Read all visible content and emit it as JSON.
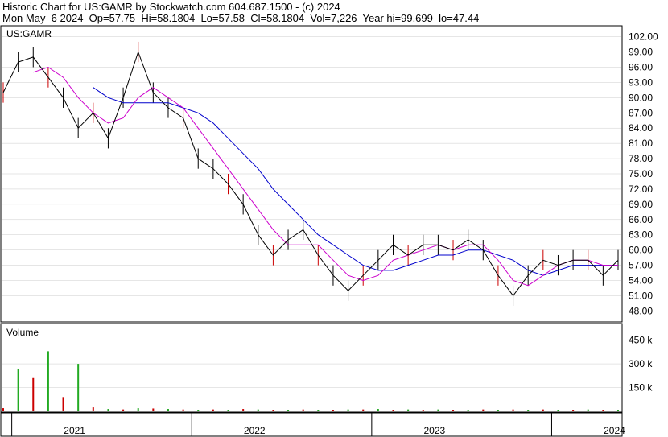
{
  "header": {
    "title": "Historic Chart for US:GAMR by Stockwatch.com 604.687.1500 - (c) 2024",
    "quote_line": "Mon May  6 2024  Op=57.75  Hi=58.1804  Lo=57.58  Cl=58.1804  Vol=7,226  Year hi=99.699  lo=47.44"
  },
  "colors": {
    "price": "#000000",
    "up_bar": "#cc0000",
    "ma_short": "#cc00cc",
    "ma_long": "#0000cc",
    "vol_up": "#22aa22",
    "vol_down": "#cc0000",
    "grid": "#cccccc"
  },
  "chart_data": [
    {
      "type": "line",
      "label": "US:GAMR",
      "ylim": [
        46,
        104
      ],
      "yticks": [
        "102.00",
        "99.00",
        "96.00",
        "93.00",
        "90.00",
        "87.00",
        "84.00",
        "81.00",
        "78.00",
        "75.00",
        "72.00",
        "69.00",
        "66.00",
        "63.00",
        "60.00",
        "57.00",
        "54.00",
        "51.00",
        "48.00"
      ],
      "x": [
        "2020-12",
        "2021-01",
        "2021-02",
        "2021-03",
        "2021-04",
        "2021-05",
        "2021-06",
        "2021-07",
        "2021-08",
        "2021-09",
        "2021-10",
        "2021-11",
        "2021-12",
        "2022-01",
        "2022-02",
        "2022-03",
        "2022-04",
        "2022-05",
        "2022-06",
        "2022-07",
        "2022-08",
        "2022-09",
        "2022-10",
        "2022-11",
        "2022-12",
        "2023-01",
        "2023-02",
        "2023-03",
        "2023-04",
        "2023-05",
        "2023-06",
        "2023-07",
        "2023-08",
        "2023-09",
        "2023-10",
        "2023-11",
        "2023-12",
        "2024-01",
        "2024-02",
        "2024-03",
        "2024-04",
        "2024-05"
      ],
      "series": [
        {
          "values": [
            91,
            97,
            98,
            94,
            90,
            84,
            87,
            82,
            90,
            99,
            91,
            88,
            86,
            78,
            76,
            73,
            69,
            63,
            59,
            62,
            64,
            59,
            55,
            52,
            55,
            58,
            61,
            59,
            61,
            61,
            60,
            62,
            60,
            55,
            51,
            55,
            58,
            57,
            58,
            58,
            55,
            58
          ]
        },
        {
          "values": [
            null,
            null,
            95,
            96,
            94,
            90,
            87,
            85,
            86,
            90,
            92,
            90,
            88,
            84,
            80,
            76,
            72,
            68,
            64,
            61,
            61,
            61,
            58,
            55,
            54,
            55,
            58,
            59,
            60,
            61,
            60,
            61,
            61,
            58,
            54,
            53,
            55,
            57,
            58,
            58,
            57,
            57
          ]
        },
        {
          "values": [
            null,
            null,
            null,
            null,
            null,
            null,
            92,
            90,
            89,
            89,
            89,
            89,
            88,
            87,
            85,
            82,
            79,
            76,
            72,
            69,
            66,
            63,
            61,
            59,
            57,
            56,
            56,
            57,
            58,
            59,
            59,
            60,
            60,
            59,
            58,
            56,
            55,
            56,
            57,
            57,
            57,
            57
          ]
        }
      ]
    },
    {
      "type": "bar",
      "label": "Volume",
      "yticks": [
        "450 k",
        "300 k",
        "150 k"
      ],
      "ylim": [
        0,
        550
      ],
      "x": [
        "2020-12",
        "2021-01",
        "2021-02",
        "2021-03",
        "2021-04",
        "2021-05",
        "2021-06",
        "2021-07",
        "2021-08",
        "2021-09",
        "2021-10",
        "2021-11",
        "2021-12",
        "2022-01",
        "2022-02",
        "2022-03",
        "2022-04",
        "2022-05",
        "2022-06",
        "2022-07",
        "2022-08",
        "2022-09",
        "2022-10",
        "2022-11",
        "2022-12",
        "2023-01",
        "2023-02",
        "2023-03",
        "2023-04",
        "2023-05",
        "2023-06",
        "2023-07",
        "2023-08",
        "2023-09",
        "2023-10",
        "2023-11",
        "2023-12",
        "2024-01",
        "2024-02",
        "2024-03",
        "2024-04",
        "2024-05"
      ],
      "values": [
        20,
        270,
        210,
        380,
        90,
        300,
        25,
        15,
        12,
        20,
        18,
        15,
        12,
        10,
        12,
        10,
        15,
        12,
        10,
        10,
        12,
        10,
        10,
        12,
        12,
        15,
        10,
        12,
        10,
        12,
        10,
        10,
        12,
        10,
        12,
        10,
        12,
        10,
        10,
        12,
        10,
        8
      ],
      "peaks": [
        280,
        380,
        300
      ]
    }
  ],
  "x_axis": {
    "labels": [
      "2021",
      "2022",
      "2023",
      "2024"
    ]
  }
}
